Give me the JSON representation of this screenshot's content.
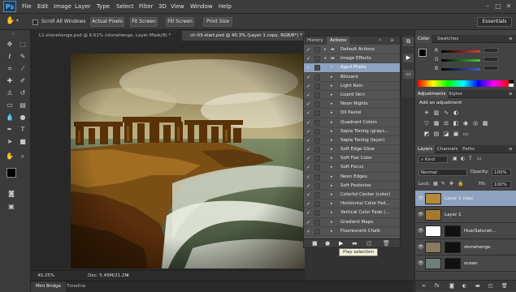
{
  "app": {
    "logo": "Ps"
  },
  "menu": [
    "File",
    "Edit",
    "Image",
    "Layer",
    "Type",
    "Select",
    "Filter",
    "3D",
    "View",
    "Window",
    "Help"
  ],
  "options_bar": {
    "scroll_all_windows": "Scroll All Windows",
    "buttons": [
      "Actual Pixels",
      "Fit Screen",
      "Fill Screen",
      "Print Size"
    ],
    "workspace": "Essentials"
  },
  "doc_tabs": [
    {
      "label": "L1-stonehenge.psd @ 6.61% (stonehenge, Layer Mask/8) *"
    },
    {
      "label": "ch-03-start.psd @ 40.3% (Layer 1 copy, RGB/8*) *"
    }
  ],
  "status": {
    "zoom": "40.25%",
    "doc": "Doc: 5.49M/21.2M"
  },
  "bottom_tabs": [
    "Mini Bridge",
    "Timeline"
  ],
  "actions_panel": {
    "tabs": [
      "History",
      "Actions"
    ],
    "rows": [
      {
        "label": "Default Actions",
        "kind": "set",
        "expanded": false
      },
      {
        "label": "Image Effects",
        "kind": "set",
        "expanded": true
      },
      {
        "label": "Aged Photo",
        "kind": "action",
        "selected": true
      },
      {
        "label": "Blizzard",
        "kind": "action"
      },
      {
        "label": "Light Rain",
        "kind": "action"
      },
      {
        "label": "Lizard Skin",
        "kind": "action"
      },
      {
        "label": "Neon Nights",
        "kind": "action"
      },
      {
        "label": "Oil Pastel",
        "kind": "action"
      },
      {
        "label": "Quadrant Colors",
        "kind": "action"
      },
      {
        "label": "Sepia Toning (grays...",
        "kind": "action"
      },
      {
        "label": "Sepia Toning (layer)",
        "kind": "action"
      },
      {
        "label": "Soft Edge Glow",
        "kind": "action"
      },
      {
        "label": "Soft Flat Color",
        "kind": "action"
      },
      {
        "label": "Soft Focus",
        "kind": "action"
      },
      {
        "label": "Neon Edges",
        "kind": "action"
      },
      {
        "label": "Soft Posterize",
        "kind": "action"
      },
      {
        "label": "Colorful Center (color)",
        "kind": "action"
      },
      {
        "label": "Horizontal Color Fad...",
        "kind": "action"
      },
      {
        "label": "Vertical Color Fade (...",
        "kind": "action"
      },
      {
        "label": "Gradient Maps",
        "kind": "action"
      },
      {
        "label": "Fluorescent Chalk",
        "kind": "action"
      }
    ],
    "tooltip": "Play selection"
  },
  "color_panel": {
    "tabs": [
      "Color",
      "Swatches"
    ],
    "channels": [
      {
        "label": "R",
        "color": "#e23b3b"
      },
      {
        "label": "G",
        "color": "#3bd23b"
      },
      {
        "label": "B",
        "color": "#3b5fe2"
      }
    ]
  },
  "adjustments_panel": {
    "tabs": [
      "Adjustments",
      "Styles"
    ],
    "title": "Add an adjustment"
  },
  "layers_panel": {
    "tabs": [
      "Layers",
      "Channels",
      "Paths"
    ],
    "kind": "Kind",
    "blend_mode": "Normal",
    "opacity_label": "Opacity:",
    "opacity": "100%",
    "lock_label": "Lock:",
    "fill_label": "Fill:",
    "fill": "100%",
    "layers": [
      {
        "name": "Layer 1 copy",
        "selected": true
      },
      {
        "name": "Layer 1"
      },
      {
        "name": "Hue/Saturati...",
        "adjustment": true
      },
      {
        "name": "stonehenge"
      },
      {
        "name": "ocean"
      }
    ]
  },
  "colors": {
    "accent_selection": "#8ea2c2",
    "panel_bg": "#535353"
  }
}
